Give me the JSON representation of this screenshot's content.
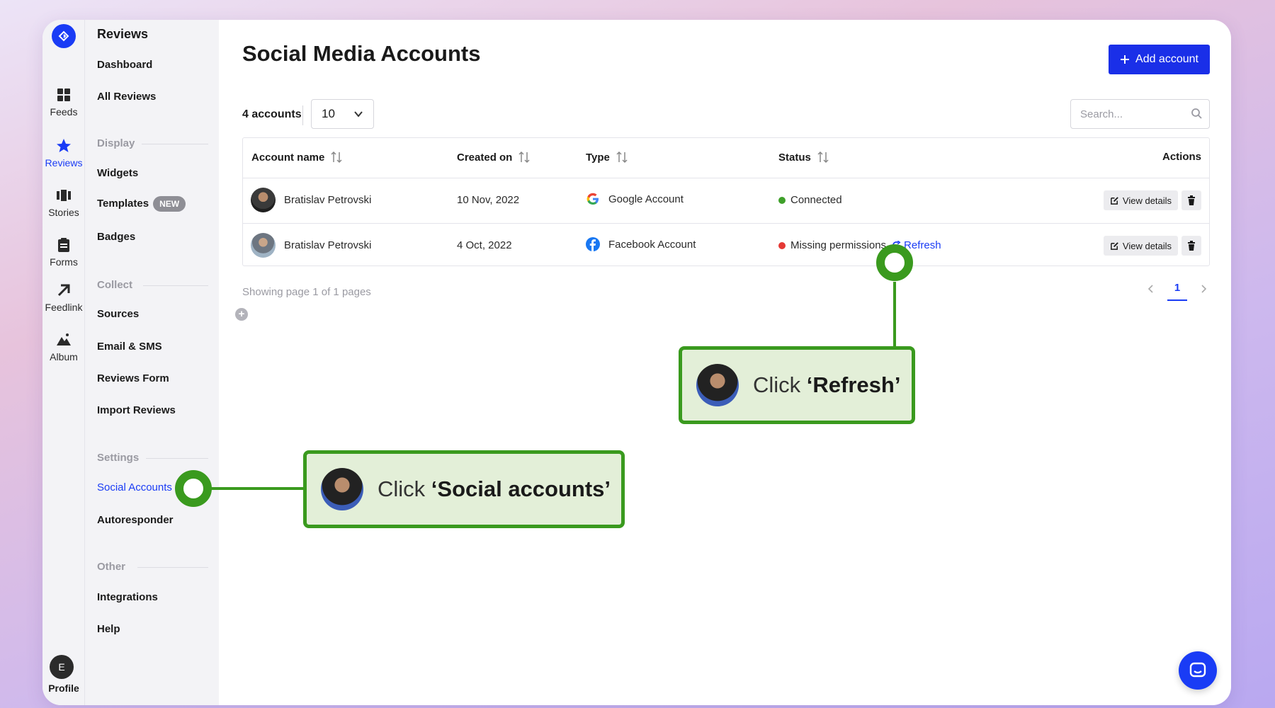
{
  "rail": {
    "items": [
      {
        "label": "Feeds",
        "icon": "grid-icon"
      },
      {
        "label": "Reviews",
        "icon": "star-icon"
      },
      {
        "label": "Stories",
        "icon": "stories-icon"
      },
      {
        "label": "Forms",
        "icon": "clipboard-icon"
      },
      {
        "label": "Feedlink",
        "icon": "arrow-up-right-icon"
      },
      {
        "label": "Album",
        "icon": "mountain-icon"
      }
    ],
    "active": "Reviews",
    "profile_initial": "E",
    "profile_label": "Profile"
  },
  "sidebar": {
    "title": "Reviews",
    "items": {
      "dashboard": "Dashboard",
      "all_reviews": "All Reviews",
      "widgets": "Widgets",
      "templates": "Templates",
      "templates_badge": "NEW",
      "badges": "Badges",
      "sources": "Sources",
      "email_sms": "Email & SMS",
      "reviews_form": "Reviews Form",
      "import_reviews": "Import Reviews",
      "social_accounts": "Social Accounts",
      "autoresponder": "Autoresponder",
      "integrations": "Integrations",
      "help": "Help"
    },
    "sections": {
      "display": "Display",
      "collect": "Collect",
      "settings": "Settings",
      "other": "Other"
    }
  },
  "main": {
    "title": "Social Media Accounts",
    "add_button": "Add account",
    "count": "4 accounts",
    "page_size": "10",
    "search_placeholder": "Search...",
    "columns": {
      "account_name": "Account name",
      "created_on": "Created on",
      "type": "Type",
      "status": "Status",
      "actions": "Actions"
    },
    "rows": [
      {
        "name": "Bratislav Petrovski",
        "created": "10 Nov, 2022",
        "type": "Google Account",
        "status": "Connected",
        "status_color": "#3fa02a",
        "refresh": ""
      },
      {
        "name": "Bratislav Petrovski",
        "created": "4 Oct, 2022",
        "type": "Facebook Account",
        "status": "Missing permissions",
        "status_color": "#e53935",
        "refresh": "Refresh"
      }
    ],
    "view_details": "View details",
    "showing": "Showing page 1 of 1 pages",
    "current_page": "1"
  },
  "callouts": {
    "refresh": {
      "prefix": "Click ",
      "bold": "‘Refresh’"
    },
    "social": {
      "prefix": "Click ",
      "bold": "‘Social accounts’"
    }
  },
  "colors": {
    "accent": "#1a3cf5",
    "callout_green": "#3a9a1e"
  }
}
